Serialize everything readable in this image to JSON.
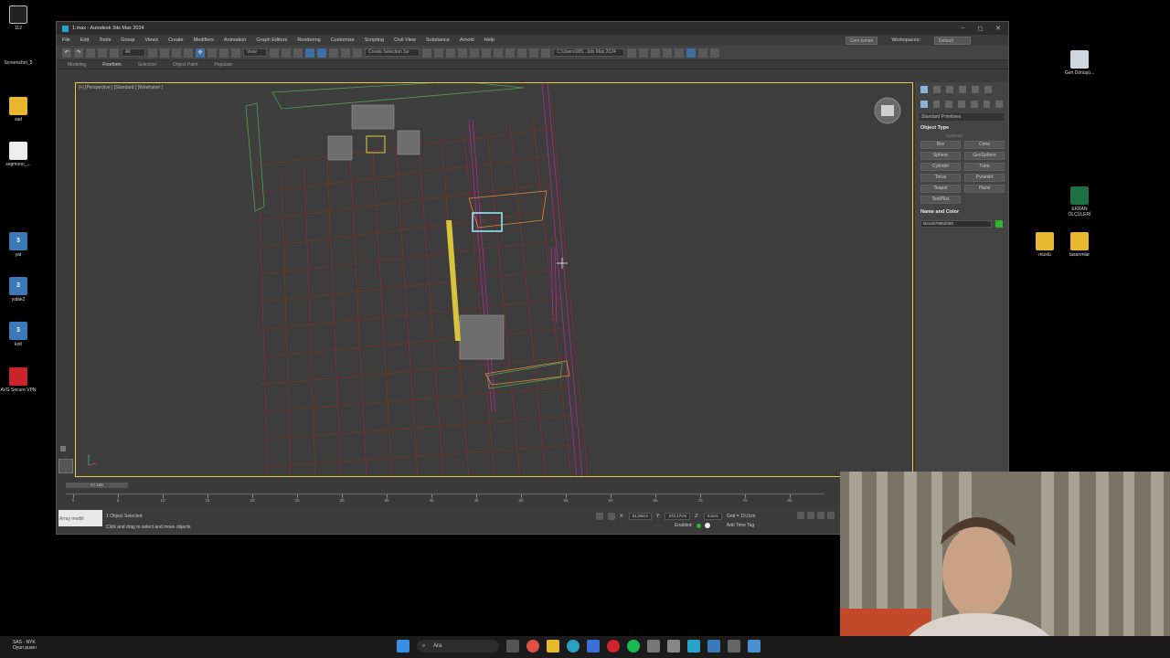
{
  "desktop": {
    "icons_left": [
      {
        "label": "112",
        "type": "app"
      },
      {
        "label": "Screenshot_5",
        "type": "file"
      },
      {
        "label": "sad",
        "type": "folder"
      },
      {
        "label": "segmono_...",
        "type": "file"
      },
      {
        "label": "yat",
        "type": "max",
        "glyph": "3"
      },
      {
        "label": "yatak2",
        "type": "max",
        "glyph": "3"
      },
      {
        "label": "kolt",
        "type": "max",
        "glyph": "3"
      },
      {
        "label": "AVG Secure VPN",
        "type": "avg"
      }
    ],
    "icons_right": [
      {
        "label": "Geri Dönüşü...",
        "type": "bin"
      },
      {
        "label": "EKRAN ÖLÇÜLERİ",
        "type": "xls"
      },
      {
        "label": "müstü",
        "type": "folder"
      },
      {
        "label": "tasarımlar",
        "type": "folder"
      }
    ]
  },
  "window": {
    "title": "1.max - Autodesk 3ds Max 2024",
    "controls": [
      "–",
      "◻",
      "✕"
    ]
  },
  "menu": {
    "items": [
      "File",
      "Edit",
      "Tools",
      "Group",
      "Views",
      "Create",
      "Modifiers",
      "Animation",
      "Graph Editors",
      "Rendering",
      "Customize",
      "Scripting",
      "Civil View",
      "Substance",
      "Arnold",
      "Help"
    ],
    "user": "Cem lumen",
    "workspaces_label": "Workspaces:",
    "workspace": "Default"
  },
  "toolbar": {
    "filter": "All",
    "view": "View",
    "selection_set": "Create Selection Se",
    "path": "C:\\Users\\905...3ds Max 2024"
  },
  "ribbon": {
    "tabs": [
      "Modeling",
      "Freeform",
      "Selection",
      "Object Paint",
      "Populate"
    ],
    "active": "Freeform"
  },
  "viewport": {
    "label": "[+] [Perspective ] [Standard ] [Wireframe ]"
  },
  "command_panel": {
    "dropdown": "Standard Primitives",
    "object_type_title": "Object Type",
    "autogrid": "AutoGrid",
    "buttons": [
      "Box",
      "Cone",
      "Sphere",
      "GeoSphere",
      "Cylinder",
      "Tube",
      "Torus",
      "Pyramid",
      "Teapot",
      "Plane",
      "TextPlus"
    ],
    "name_color_title": "Name and Color",
    "object_name": "Box1578962099",
    "color": "#2cb82c"
  },
  "timeline": {
    "frame": "0 / 100",
    "ticks": [
      "0",
      "5",
      "10",
      "15",
      "20",
      "25",
      "30",
      "35",
      "40",
      "45",
      "50",
      "55",
      "60",
      "65",
      "70",
      "75",
      "80"
    ]
  },
  "status": {
    "maxscript": "Array modifi",
    "selected": "1 Object Selected",
    "prompt": "Click and drag to select and move objects",
    "x_label": "X:",
    "x": "51,08cm",
    "y_label": "Y:",
    "y": "372,17cm",
    "z_label": "Z:",
    "z": "0,0cm",
    "grid": "Grid = 10,0cm",
    "enabled": "Enabled:",
    "add_time_tag": "Add Time Tag"
  },
  "taskbar": {
    "weather_line1": "SAS - NYK",
    "weather_line2": "Oyun puanı",
    "search": "Ara"
  }
}
